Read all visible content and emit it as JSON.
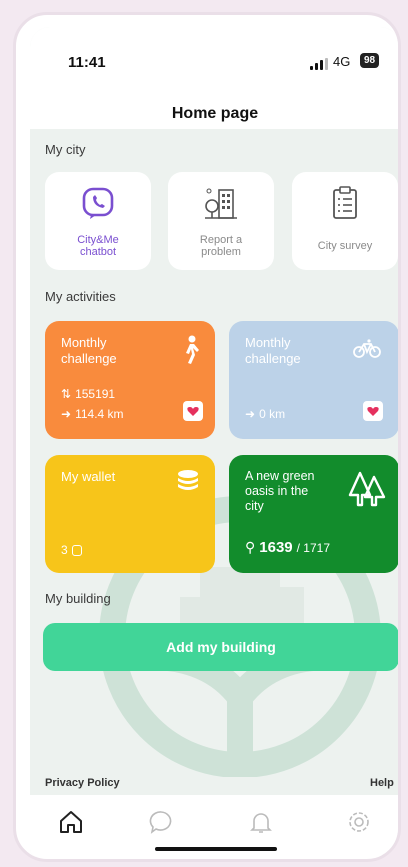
{
  "status": {
    "time": "11:41",
    "network": "4G",
    "battery": "98"
  },
  "header": {
    "title": "Home page"
  },
  "sections": {
    "city": "My city",
    "activities": "My activities",
    "building": "My building"
  },
  "city_tiles": [
    {
      "icon": "viber-chat-icon",
      "label": "City&Me\nchatbot"
    },
    {
      "icon": "report-building-icon",
      "label": "Report a\nproblem"
    },
    {
      "icon": "clipboard-survey-icon",
      "label": "City survey"
    }
  ],
  "challenges": [
    {
      "title": "Monthly\nchallenge",
      "icon": "walking-icon",
      "steps": "155191",
      "distance": "114.4 km",
      "color": "#f98b3d"
    },
    {
      "title": "Monthly\nchallenge",
      "icon": "bicycle-icon",
      "distance": "0 km",
      "color": "#bcd2e8"
    }
  ],
  "wallet": {
    "title": "My wallet",
    "icon": "coins-icon",
    "value": "3",
    "color": "#f7c51a"
  },
  "oasis": {
    "title": "A new green\noasis in the\ncity",
    "icon": "trees-icon",
    "count": "1639",
    "total": "/ 1717",
    "color": "#128c2c"
  },
  "add_building": {
    "label": "Add my building"
  },
  "footer": {
    "privacy": "Privacy Policy",
    "help": "Help"
  },
  "nav": [
    "home-icon",
    "chat-icon",
    "bell-icon",
    "settings-icon"
  ],
  "colors": {
    "accent_green": "#41d598",
    "purple": "#7a4fd0"
  }
}
